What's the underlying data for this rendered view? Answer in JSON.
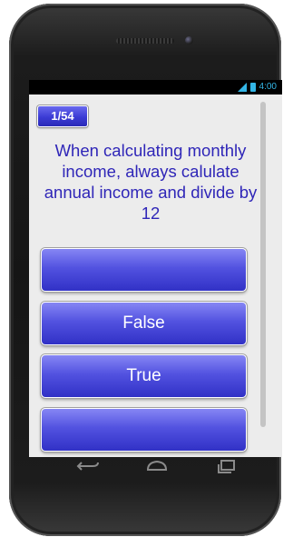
{
  "status_bar": {
    "time": "4:00",
    "icons": [
      "signal-icon",
      "battery-icon"
    ],
    "accent_color": "#33b5e5"
  },
  "quiz": {
    "counter": "1/54",
    "question": "When calculating monthly income, always calulate annual income and divide by 12",
    "answers": [
      "",
      "False",
      "True",
      ""
    ]
  },
  "navigation": {
    "icons": [
      "back-icon",
      "home-icon",
      "recent-apps-icon"
    ]
  },
  "colors": {
    "question_text": "#2f26b8",
    "button_top": "#8686f4",
    "button_bottom": "#3131c6",
    "background": "#ececec"
  }
}
